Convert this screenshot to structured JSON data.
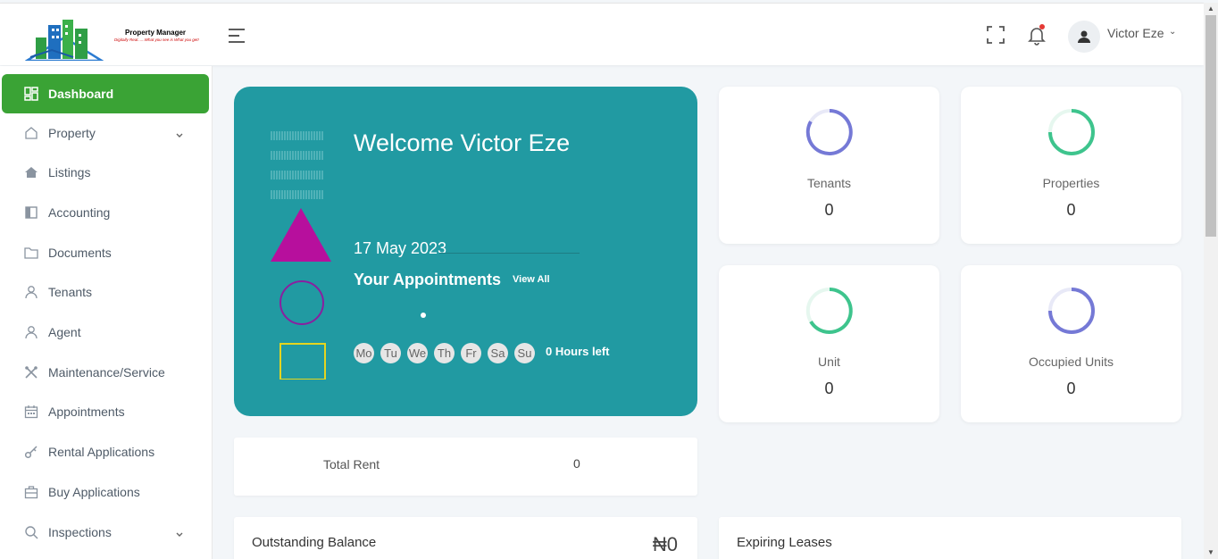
{
  "brand": {
    "name": "Property Manager",
    "tagline": "Digitally Real......What you see is What you get!"
  },
  "header": {
    "user_name": "Victor Eze",
    "icons": [
      "menu-icon",
      "fullscreen-icon",
      "bell-icon",
      "user-icon",
      "chevron-down-icon"
    ]
  },
  "sidebar": {
    "items": [
      {
        "label": "Dashboard",
        "icon": "dashboard-icon",
        "active": true
      },
      {
        "label": "Property",
        "icon": "home-icon",
        "has_submenu": true
      },
      {
        "label": "Listings",
        "icon": "house-fill-icon"
      },
      {
        "label": "Accounting",
        "icon": "ledger-icon"
      },
      {
        "label": "Documents",
        "icon": "folder-icon"
      },
      {
        "label": "Tenants",
        "icon": "person-icon"
      },
      {
        "label": "Agent",
        "icon": "person-icon"
      },
      {
        "label": "Maintenance/Service",
        "icon": "tools-icon"
      },
      {
        "label": "Appointments",
        "icon": "calendar-icon"
      },
      {
        "label": "Rental Applications",
        "icon": "key-icon"
      },
      {
        "label": "Buy Applications",
        "icon": "briefcase-icon"
      },
      {
        "label": "Inspections",
        "icon": "search-icon",
        "has_submenu": true
      }
    ]
  },
  "welcome": {
    "title": "Welcome Victor Eze",
    "date": "17 May 2023",
    "appointments_title": "Your Appointments",
    "view_all": "View All",
    "days": [
      "Mo",
      "Tu",
      "We",
      "Th",
      "Fr",
      "Sa",
      "Su"
    ],
    "hours_left": "0 Hours left"
  },
  "stats": [
    {
      "label": "Tenants",
      "value": "0"
    },
    {
      "label": "Properties",
      "value": "0"
    },
    {
      "label": "Unit",
      "value": "0"
    },
    {
      "label": "Occupied Units",
      "value": "0"
    }
  ],
  "total_rent": {
    "label": "Total Rent",
    "value": "0"
  },
  "outstanding": {
    "label": "Outstanding Balance",
    "amount": "₦0"
  },
  "expiring": {
    "label": "Expiring Leases"
  },
  "colors": {
    "accent_green": "#3aa335",
    "welcome_teal": "#219aa2",
    "ring_purple": "#7579d6",
    "ring_green": "#3ec48d",
    "shape_magenta": "#b70f9d",
    "shape_yellow": "#e5d51f"
  }
}
